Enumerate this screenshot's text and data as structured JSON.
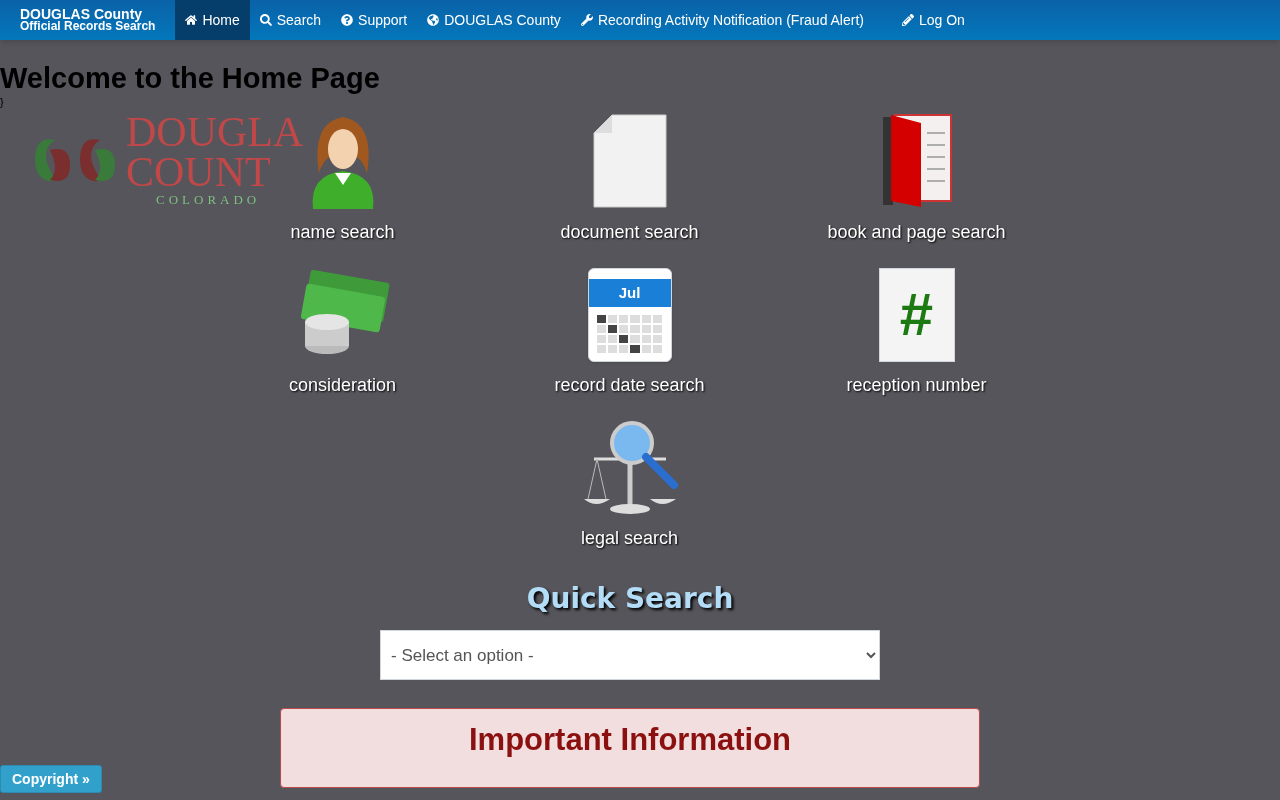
{
  "navbar": {
    "brand": [
      "DOUGLAS County",
      "Official Records Search"
    ],
    "items": [
      {
        "label": "Home",
        "kind": "home",
        "selected": true
      },
      {
        "label": "Search",
        "kind": "search",
        "selected": false
      },
      {
        "label": "Support",
        "kind": "support",
        "selected": false
      },
      {
        "label": "DOUGLAS County",
        "kind": "county",
        "selected": false
      },
      {
        "label": "Recording Activity Notification (Fraud Alert)",
        "kind": "notification",
        "selected": false
      },
      {
        "label": "Log On",
        "kind": "logon",
        "selected": false
      }
    ]
  },
  "heading": "Welcome to the Home Page",
  "stray_text": "}",
  "logo": {
    "lines": [
      "DOUGLA",
      "COUNT",
      "COLORADO"
    ]
  },
  "tiles": [
    {
      "label": "name search",
      "kind": "name"
    },
    {
      "label": "document search",
      "kind": "document"
    },
    {
      "label": "book and page search",
      "kind": "bookpage"
    },
    {
      "label": "consideration",
      "kind": "consideration"
    },
    {
      "label": "record date search",
      "kind": "date",
      "icon_text": "Jul"
    },
    {
      "label": "reception number",
      "kind": "reception",
      "icon_text": "#"
    },
    {
      "label": "legal search",
      "kind": "legal"
    }
  ],
  "quick_search": {
    "title": "Quick Search",
    "select_value": "- Select an option -"
  },
  "important": {
    "title": "Important Information"
  },
  "copyright_button": "Copyright »"
}
